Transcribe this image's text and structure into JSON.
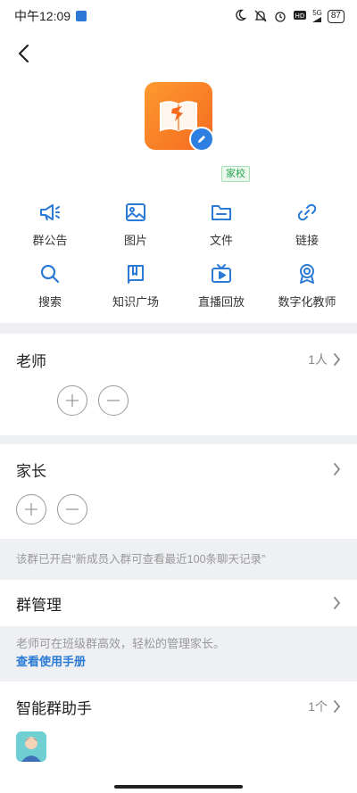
{
  "status_bar": {
    "time": "中午12:09",
    "network": "5G",
    "battery": "87"
  },
  "header": {
    "tag": "家校"
  },
  "functions": [
    {
      "label": "群公告",
      "icon": "megaphone-icon"
    },
    {
      "label": "图片",
      "icon": "image-icon"
    },
    {
      "label": "文件",
      "icon": "folder-icon"
    },
    {
      "label": "链接",
      "icon": "link-icon"
    },
    {
      "label": "搜索",
      "icon": "search-icon"
    },
    {
      "label": "知识广场",
      "icon": "book-icon"
    },
    {
      "label": "直播回放",
      "icon": "tv-icon"
    },
    {
      "label": "数字化教师",
      "icon": "award-icon"
    }
  ],
  "teachers": {
    "title": "老师",
    "count": "1人"
  },
  "parents": {
    "title": "家长",
    "notice": "该群已开启“新成员入群可查看最近100条聊天记录”"
  },
  "group_manage": {
    "title": "群管理",
    "tip": "老师可在班级群高效，轻松的管理家长。",
    "link": "查看使用手册"
  },
  "assistant": {
    "title": "智能群助手",
    "count": "1个"
  },
  "colors": {
    "accent": "#2a7ad6",
    "avatar_orange": "#f36a20",
    "tag_green": "#2aa451"
  }
}
